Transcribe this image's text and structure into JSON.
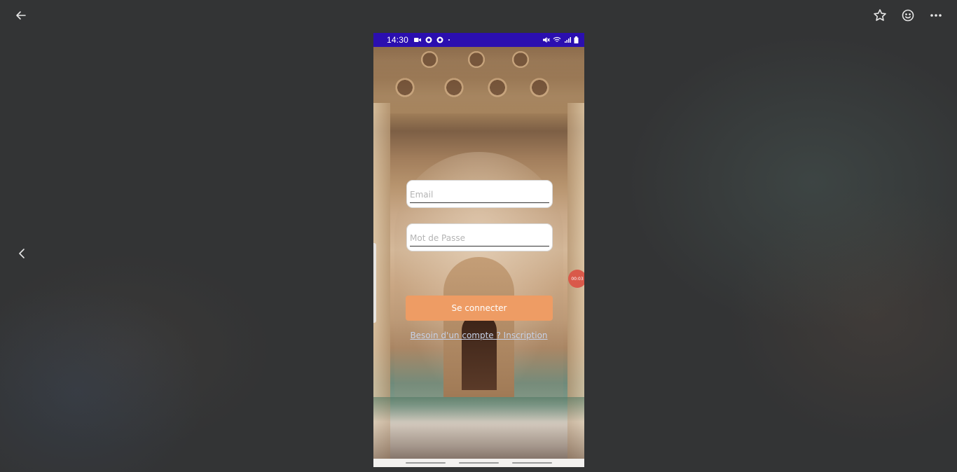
{
  "viewer": {
    "back_icon": "arrow-left-icon",
    "prev_icon": "chevron-left-icon",
    "favorite_icon": "star-icon",
    "react_icon": "smiley-icon",
    "more_icon": "more-horizontal-icon"
  },
  "phone": {
    "status_bar": {
      "time": "14:30",
      "icons_left": [
        "video-camera-icon",
        "app-icon",
        "app-icon",
        "dot-icon"
      ],
      "icons_right": [
        "mute-icon",
        "wifi-icon",
        "signal-icon",
        "battery-icon"
      ],
      "color": "#2b0fb0"
    },
    "login_form": {
      "email_placeholder": "Email",
      "password_placeholder": "Mot de Passe",
      "login_button": "Se connecter",
      "register_link": "Besoin d'un compte ? Inscription",
      "button_color": "#ee9c64"
    },
    "recording_bubble": "00:03"
  }
}
